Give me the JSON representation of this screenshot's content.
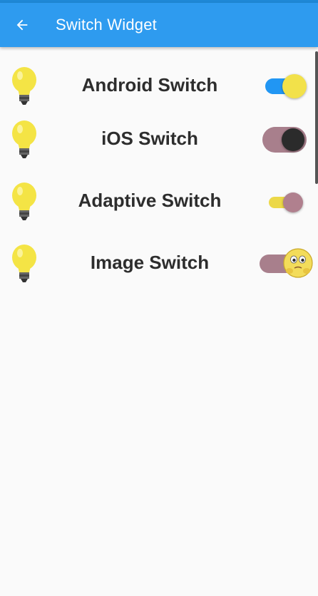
{
  "appbar": {
    "title": "Switch Widget",
    "back_icon": "arrow-back-icon",
    "background": "#2e9bef"
  },
  "rows": [
    {
      "label": "Android Switch",
      "icon": "lightbulb-icon",
      "switch": {
        "on": true,
        "track_color": "#2196f3",
        "thumb_color": "#f2e14a"
      }
    },
    {
      "label": "iOS Switch",
      "icon": "lightbulb-icon",
      "switch": {
        "on": true,
        "track_color": "#a87f8c",
        "thumb_color": "#2b2b2b"
      }
    },
    {
      "label": "Adaptive Switch",
      "icon": "lightbulb-icon",
      "switch": {
        "on": true,
        "track_color": "#ecd848",
        "thumb_color": "#b0808e"
      }
    },
    {
      "label": "Image Switch",
      "icon": "lightbulb-icon",
      "switch": {
        "on": true,
        "track_color": "#a87f8c",
        "thumb_icon": "emoji-face-icon"
      }
    }
  ]
}
